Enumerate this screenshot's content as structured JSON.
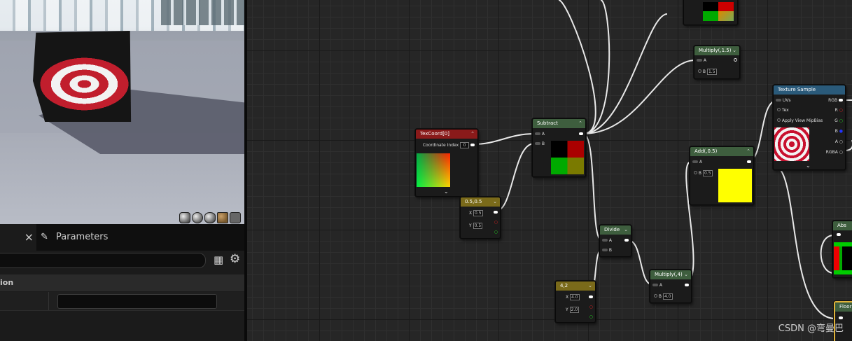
{
  "panel": {
    "tab_details_close": "×",
    "tab_parameters": "Parameters",
    "section_title_fragment": "ion"
  },
  "graph": {
    "nodes": {
      "texcoord": {
        "title": "TexCoord[0]",
        "pin_label": "Coordinate Index",
        "pin_value": "0"
      },
      "subtract": {
        "title": "Subtract",
        "pin_a": "A",
        "pin_b": "B"
      },
      "const_05": {
        "title": "0.5,0.5",
        "x_label": "X",
        "x_value": "0.5",
        "y_label": "Y",
        "y_value": "0.5"
      },
      "multiply_15": {
        "title": "Multiply(,1.5)",
        "pin_a": "A",
        "pin_b": "B",
        "b_value": "1.5"
      },
      "texture_sample": {
        "title": "Texture Sample",
        "in_uvs": "UVs",
        "in_tex": "Tex",
        "in_mip": "Apply View MipBias",
        "out_rgb": "RGB",
        "out_r": "R",
        "out_g": "G",
        "out_b": "B",
        "out_a": "A",
        "out_rgba": "RGBA"
      },
      "add_05": {
        "title": "Add(,0.5)",
        "pin_a": "A",
        "pin_b": "B",
        "b_value": "0.5"
      },
      "divide": {
        "title": "Divide",
        "pin_a": "A",
        "pin_b": "B"
      },
      "multiply_4": {
        "title": "Multiply(,4)",
        "pin_a": "A",
        "pin_b": "B",
        "b_value": "4.0"
      },
      "const_42": {
        "title": "4,2",
        "x_label": "X",
        "x_value": "4.0",
        "y_label": "Y",
        "y_value": "2.0"
      },
      "abs": {
        "title": "Abs"
      },
      "floor": {
        "title": "Floor"
      }
    }
  },
  "watermark": "CSDN @弯曼巴",
  "colors": {
    "texcoord_header": "#8a1a1a",
    "math_header": "#3e5e3e",
    "const_header": "#7a6a1a",
    "texture_header": "#2a5a7a",
    "selection": "#e0b23a"
  }
}
